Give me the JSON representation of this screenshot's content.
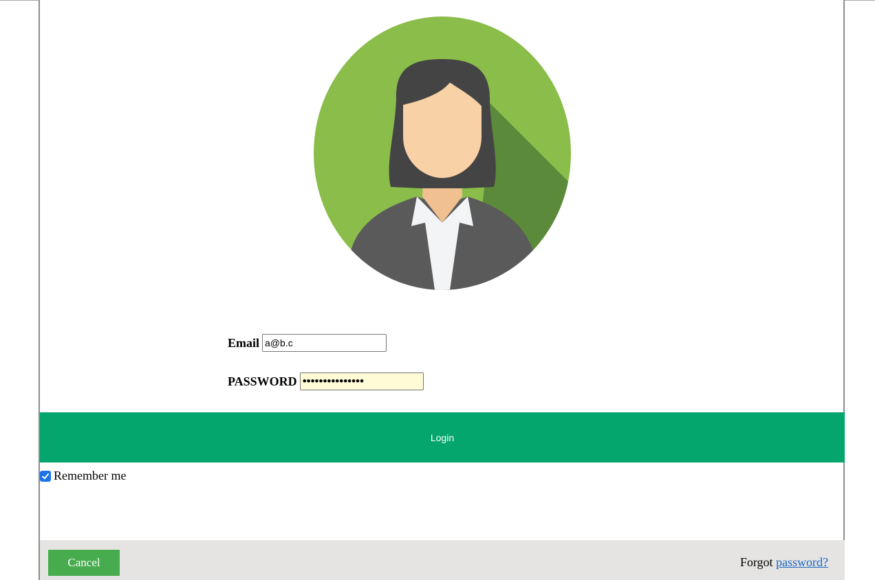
{
  "avatar": {
    "icon": "woman-avatar-icon",
    "colors": {
      "background": "#8bbd4b",
      "shadow": "#5b8a3b",
      "hair": "#444444",
      "skin": "#f9d1a6",
      "jacket": "#5a5a5a",
      "shirt": "#f2f4f5"
    }
  },
  "form": {
    "email_label": "Email",
    "email_value": "a@b.c",
    "password_label": "PASSWORD",
    "password_value": "•••••••••••••••"
  },
  "login": {
    "label": "Login",
    "color": "#04a66e"
  },
  "remember": {
    "label": "Remember me",
    "checked": true
  },
  "footer": {
    "cancel_label": "Cancel",
    "forgot_text": "Forgot",
    "forgot_link": "password?"
  }
}
